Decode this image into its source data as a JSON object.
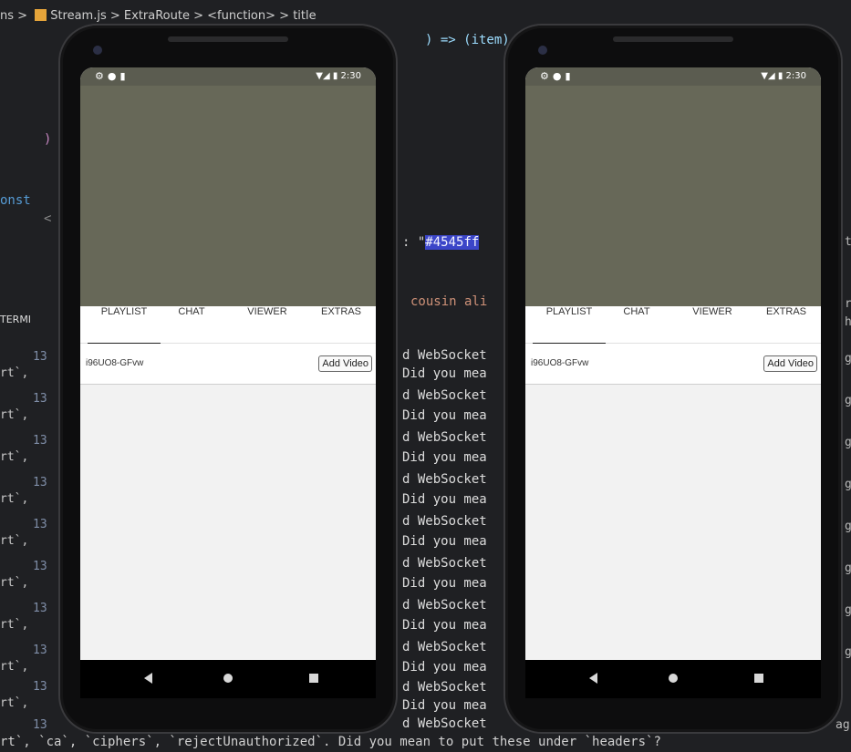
{
  "editor": {
    "breadcrumb": [
      "ns >",
      "Stream.js >",
      "ExtraRoute >",
      "<function> >",
      "title"
    ],
    "code_snippets": {
      "close_paren": ")",
      "const_kw": "onst",
      "lt": "<",
      "color_prefix": ": \"",
      "color_value": "#4545ff",
      "cousin": "cousin ali",
      "item_arrow": ") => (item)"
    },
    "terminal_label": "TERMI",
    "terminal_lines": [
      {
        "num": "13",
        "text": "rt`,"
      },
      {
        "num": "13",
        "text": "rt`,"
      },
      {
        "num": "13",
        "text": "rt`,"
      },
      {
        "num": "13",
        "text": "rt`,"
      },
      {
        "num": "13",
        "text": "rt`,"
      },
      {
        "num": "13",
        "text": "rt`,"
      },
      {
        "num": "13",
        "text": "rt`,"
      },
      {
        "num": "13",
        "text": "rt`,"
      },
      {
        "num": "13",
        "text": "rt`,"
      },
      {
        "num": "13",
        "text": "rt`,"
      }
    ],
    "mid_lines": [
      "d WebSocket",
      "Did you mea"
    ],
    "bottom_line": "rt`, `ca`, `ciphers`, `rejectUnauthorized`. Did you mean to put these under `headers`?",
    "right_chars": [
      "t",
      "r",
      "h",
      "g",
      "g",
      "g",
      "g",
      "g",
      "g",
      "g",
      "g",
      "ag"
    ]
  },
  "phones": [
    {
      "status_time": "2:30",
      "tabs": [
        "PLAYLIST",
        "CHAT",
        "VIEWER",
        "EXTRAS"
      ],
      "active_tab": "PLAYLIST",
      "video_id": "i96UO8-GFvw",
      "add_button": "Add Video"
    },
    {
      "status_time": "2:30",
      "tabs": [
        "PLAYLIST",
        "CHAT",
        "VIEWER",
        "EXTRAS"
      ],
      "active_tab": "PLAYLIST",
      "video_id": "i96UO8-GFvw",
      "add_button": "Add Video"
    }
  ],
  "colors": {
    "video_bg": "#676858",
    "status_bg": "#5b5c50",
    "highlight": "#3b45c8"
  }
}
